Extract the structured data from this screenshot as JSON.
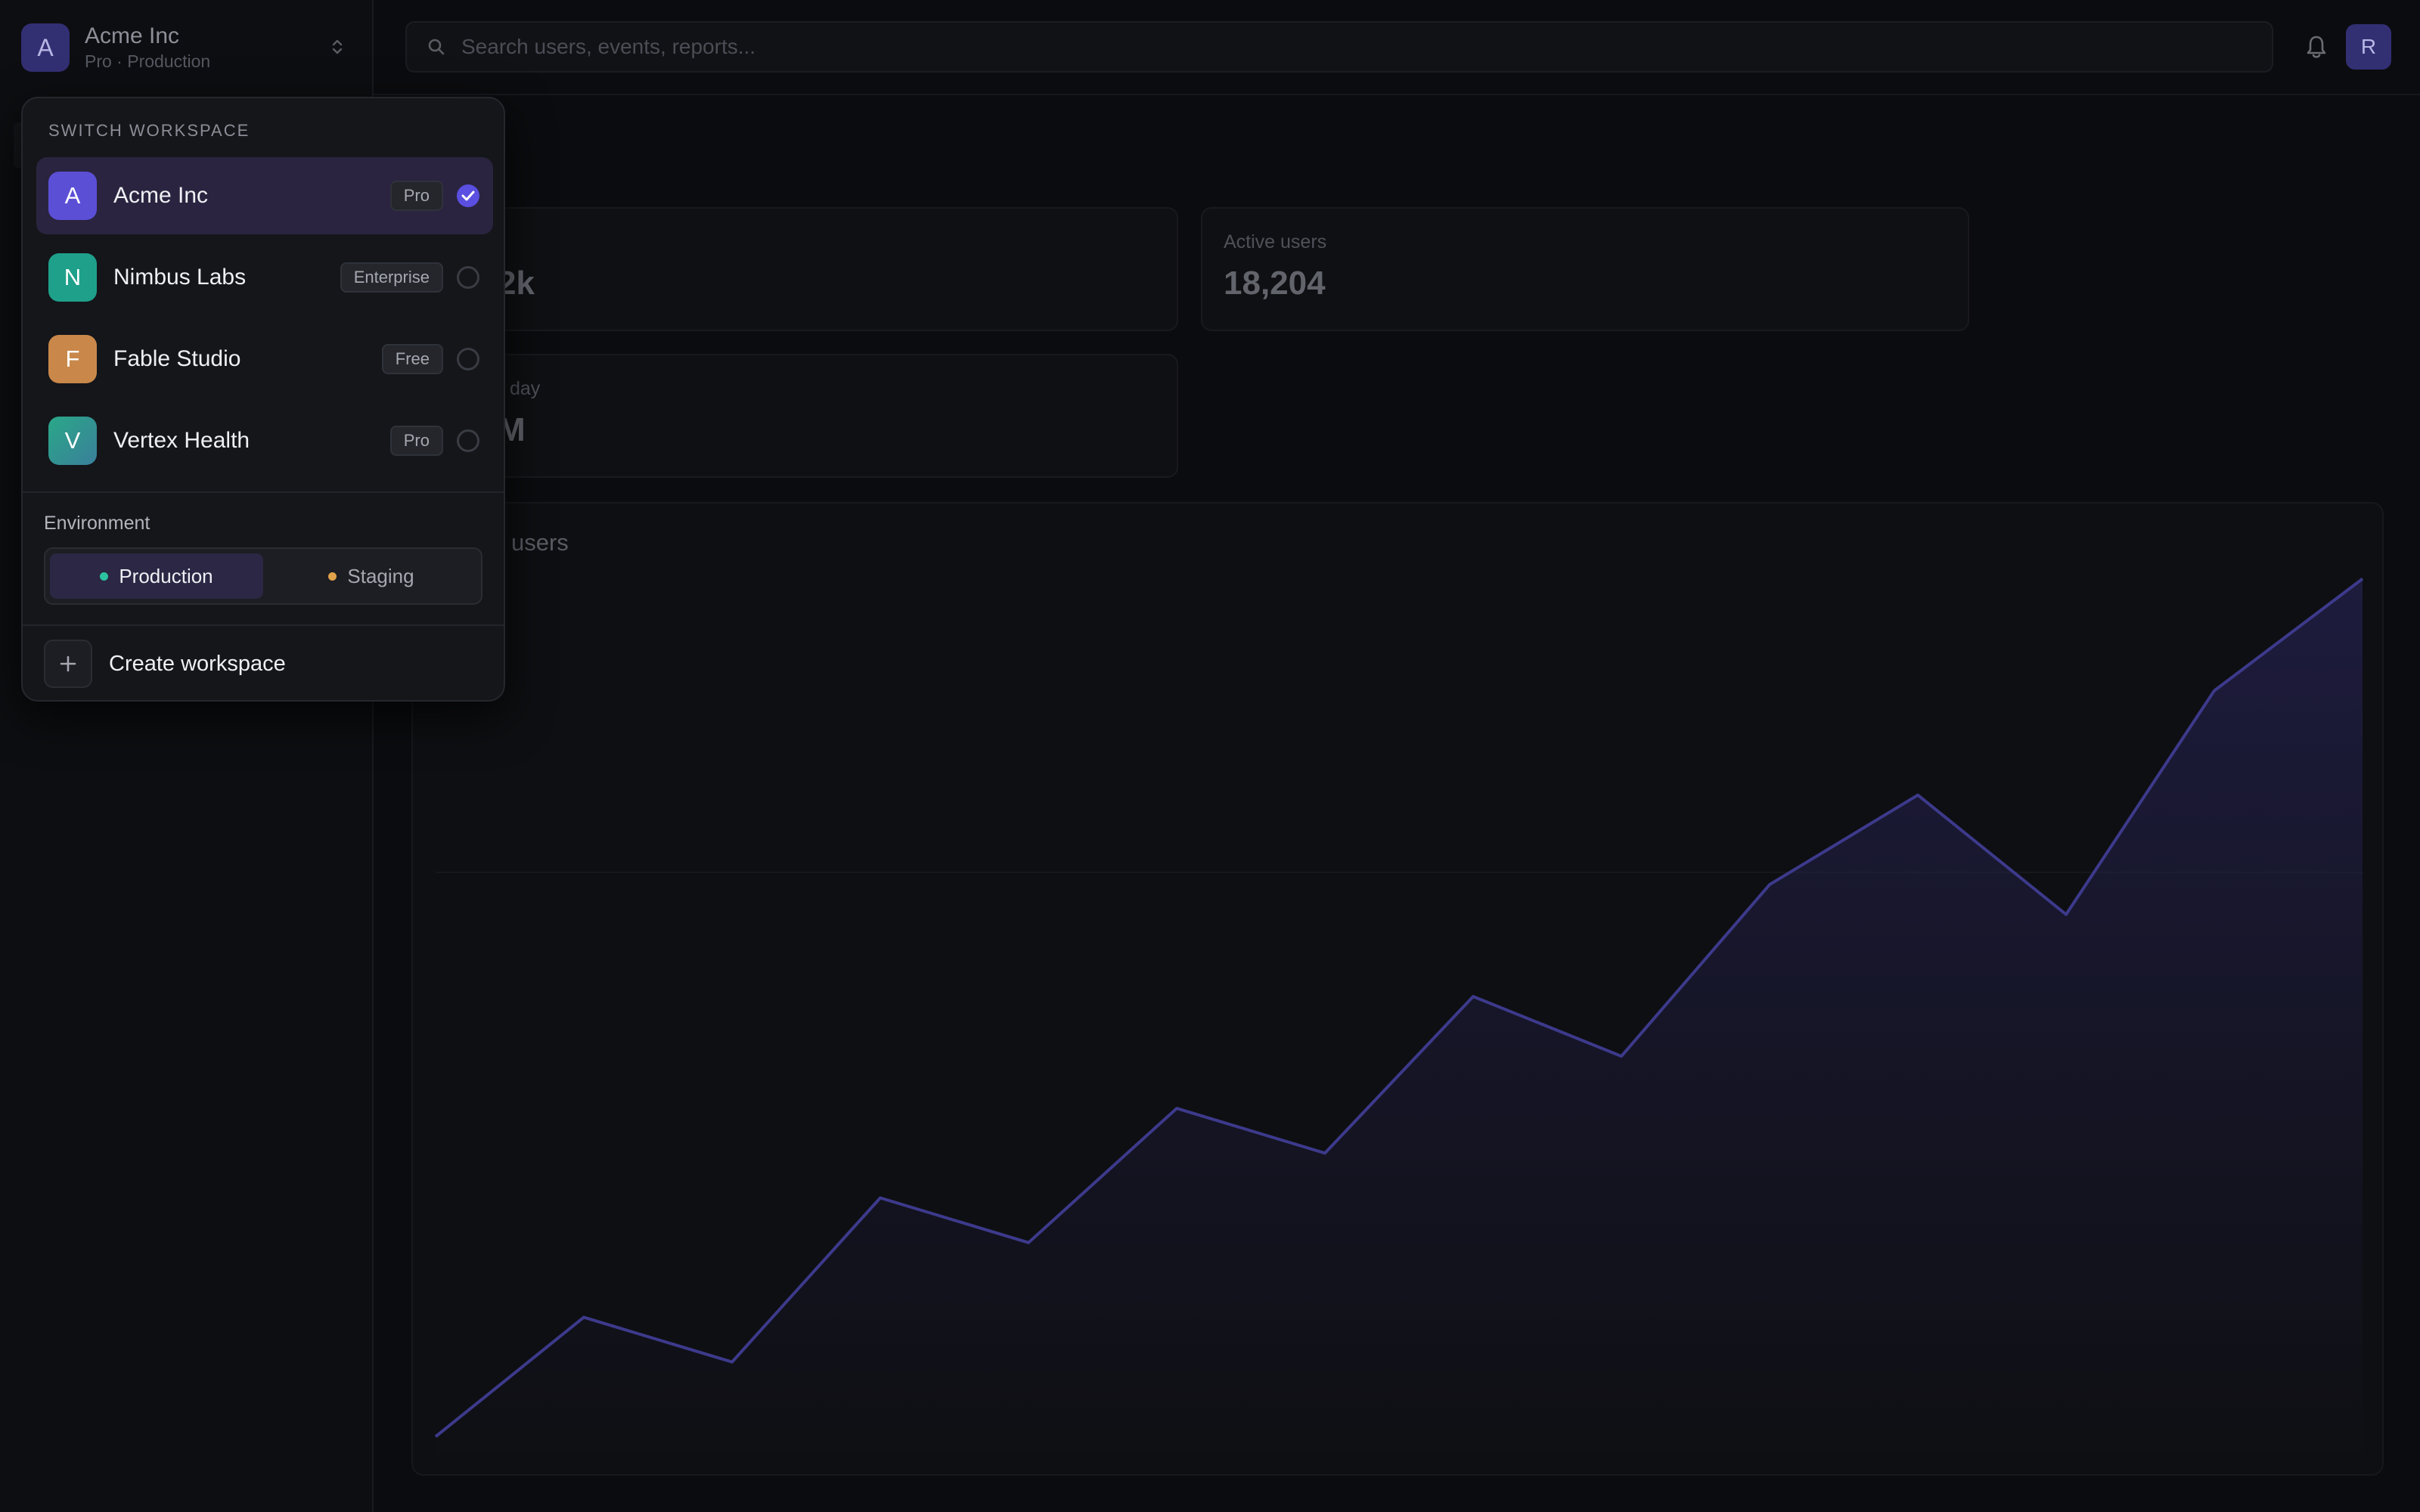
{
  "workspace_trigger": {
    "avatar_letter": "A",
    "name": "Acme Inc",
    "subtitle": "Pro · Production"
  },
  "search": {
    "placeholder": "Search users, events, reports..."
  },
  "user_avatar": "R",
  "page": {
    "title": "iew"
  },
  "cards": [
    {
      "label": "",
      "value": "2k"
    },
    {
      "label": "Active users",
      "value": "18,204"
    },
    {
      "label": "day",
      "value": "M"
    }
  ],
  "chart_card": {
    "title": "users"
  },
  "chart_data": {
    "type": "area",
    "title": "",
    "xlabel": "",
    "ylabel": "",
    "x": [
      0,
      1,
      2,
      3,
      4,
      5,
      6,
      7,
      8,
      9,
      10,
      11,
      12,
      13
    ],
    "values": [
      2,
      18,
      12,
      34,
      28,
      46,
      40,
      61,
      53,
      76,
      88,
      72,
      102,
      117
    ],
    "ylim": [
      0,
      120
    ],
    "color": "#3d3a8c",
    "grid": false
  },
  "switcher": {
    "heading": "SWITCH WORKSPACE",
    "items": [
      {
        "letter": "A",
        "name": "Acme Inc",
        "plan": "Pro",
        "selected": true,
        "color": "#5b4fd6"
      },
      {
        "letter": "N",
        "name": "Nimbus Labs",
        "plan": "Enterprise",
        "selected": false,
        "color": "#1fa08a"
      },
      {
        "letter": "F",
        "name": "Fable Studio",
        "plan": "Free",
        "selected": false,
        "color": "#c9884a"
      },
      {
        "letter": "V",
        "name": "Vertex Health",
        "plan": "Pro",
        "selected": false,
        "color": "#26a08f"
      }
    ],
    "environment_label": "Environment",
    "environments": [
      {
        "label": "Production",
        "dot_color": "#2cc4a0",
        "active": true
      },
      {
        "label": "Staging",
        "dot_color": "#e0a24a",
        "active": false
      }
    ],
    "create_label": "Create workspace"
  },
  "colors": {
    "accent": "#5a4fe0",
    "selected_row": "#2a2440"
  }
}
